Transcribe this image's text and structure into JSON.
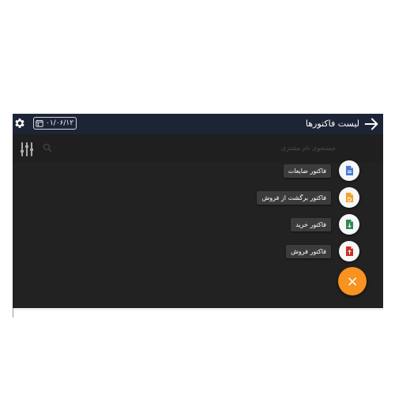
{
  "appbar": {
    "title": "لیست فاکتورها",
    "date": "۰۱/۰۶/۱۲",
    "back_icon": "arrow-right-icon",
    "settings_icon": "gear-icon",
    "calendar_icon": "calendar-icon"
  },
  "search": {
    "placeholder": "جستجوی نام مشتری",
    "filter_icon": "sliders-icon",
    "search_icon": "search-icon"
  },
  "fab_menu": {
    "items": [
      {
        "label": "فاکتور ضایعات",
        "icon": "document-icon",
        "color": "#4a7bd6"
      },
      {
        "label": "فاکتور برگشت از فروش",
        "icon": "return-document-icon",
        "color": "#f2a12b"
      },
      {
        "label": "فاکتور خرید",
        "icon": "download-document-icon",
        "color": "#2e8b4e"
      },
      {
        "label": "فاکتور فروش",
        "icon": "upload-document-icon",
        "color": "#c8322a"
      }
    ],
    "main_fab": {
      "label": "×",
      "icon": "close-icon",
      "color": "#f7931e"
    }
  }
}
